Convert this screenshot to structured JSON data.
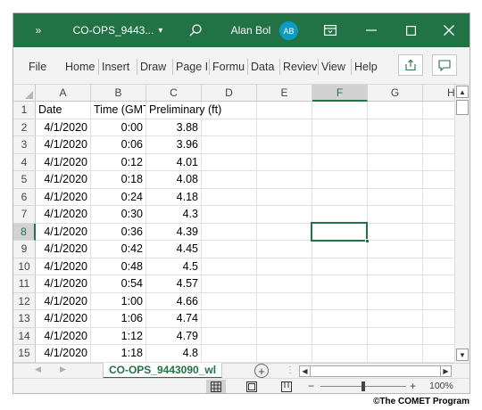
{
  "titlebar": {
    "quick_access": "»",
    "file_name": "CO-OPS_9443...",
    "file_menu_arrow": "▾",
    "user_name": "Alan Bol",
    "user_initials": "AB"
  },
  "ribbon": {
    "tabs": [
      "File",
      "Home",
      "Insert",
      "Draw",
      "Page I",
      "Formu",
      "Data",
      "Reviev",
      "View",
      "Help"
    ]
  },
  "grid": {
    "columns": [
      "A",
      "B",
      "C",
      "D",
      "E",
      "F",
      "G",
      "H"
    ],
    "selected_column": "F",
    "selected_row": "8",
    "header_row": {
      "row": "1",
      "a": "Date",
      "b": "Time (GMT)",
      "c": "Preliminary (ft)"
    },
    "rows": [
      {
        "row": "2",
        "date": "4/1/2020",
        "time": "0:00",
        "value": "3.88"
      },
      {
        "row": "3",
        "date": "4/1/2020",
        "time": "0:06",
        "value": "3.96"
      },
      {
        "row": "4",
        "date": "4/1/2020",
        "time": "0:12",
        "value": "4.01"
      },
      {
        "row": "5",
        "date": "4/1/2020",
        "time": "0:18",
        "value": "4.08"
      },
      {
        "row": "6",
        "date": "4/1/2020",
        "time": "0:24",
        "value": "4.18"
      },
      {
        "row": "7",
        "date": "4/1/2020",
        "time": "0:30",
        "value": "4.3"
      },
      {
        "row": "8",
        "date": "4/1/2020",
        "time": "0:36",
        "value": "4.39"
      },
      {
        "row": "9",
        "date": "4/1/2020",
        "time": "0:42",
        "value": "4.45"
      },
      {
        "row": "10",
        "date": "4/1/2020",
        "time": "0:48",
        "value": "4.5"
      },
      {
        "row": "11",
        "date": "4/1/2020",
        "time": "0:54",
        "value": "4.57"
      },
      {
        "row": "12",
        "date": "4/1/2020",
        "time": "1:00",
        "value": "4.66"
      },
      {
        "row": "13",
        "date": "4/1/2020",
        "time": "1:06",
        "value": "4.74"
      },
      {
        "row": "14",
        "date": "4/1/2020",
        "time": "1:12",
        "value": "4.79"
      },
      {
        "row": "15",
        "date": "4/1/2020",
        "time": "1:18",
        "value": "4.8"
      }
    ]
  },
  "sheets": {
    "active": "CO-OPS_9443090_wl",
    "add_sheet": "+"
  },
  "status": {
    "zoom_minus": "−",
    "zoom_plus": "+",
    "zoom": "100%"
  },
  "credit": "©The COMET Program",
  "colors": {
    "accent": "#217346",
    "avatar": "#0e9cc4"
  }
}
